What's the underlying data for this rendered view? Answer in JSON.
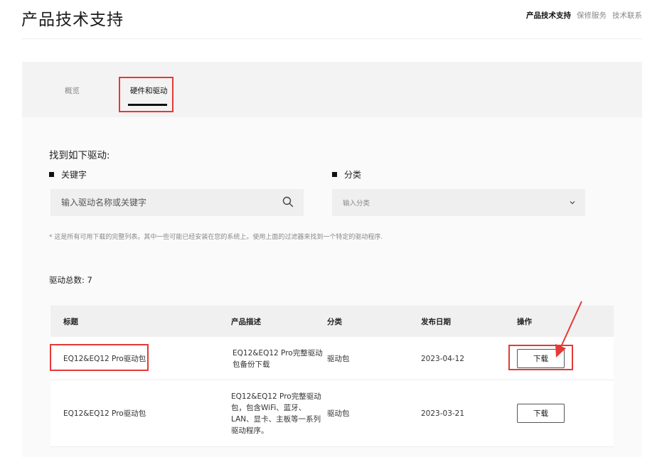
{
  "header": {
    "title": "产品技术支持",
    "nav": [
      {
        "label": "产品技术支持",
        "active": true
      },
      {
        "label": "保修服务",
        "active": false
      },
      {
        "label": "技术联系",
        "active": false
      }
    ]
  },
  "tabs": [
    {
      "label": "概览",
      "active": false
    },
    {
      "label": "硬件和驱动",
      "active": true
    }
  ],
  "drivers": {
    "section_title": "找到如下驱动:",
    "keyword_label": "关键字",
    "keyword_placeholder": "输入驱动名称或关键字",
    "category_label": "分类",
    "category_placeholder": "输入分类",
    "note": "* 这是所有可用下载的完整列表。其中一些可能已经安装在您的系统上。使用上面的过滤器来找到一个特定的驱动程序.",
    "total": "驱动总数: 7"
  },
  "table": {
    "headers": [
      "标题",
      "产品描述",
      "分类",
      "发布日期",
      "操作"
    ],
    "rows": [
      {
        "title": "EQ12&EQ12 Pro驱动包",
        "desc_lines": [
          "EQ12&EQ12 Pro完整驱动",
          "包备份下载"
        ],
        "category": "驱动包",
        "date": "2023-04-12",
        "action": "下载"
      },
      {
        "title": "EQ12&EQ12 Pro驱动包",
        "desc_lines": [
          "EQ12&EQ12 Pro完整驱动",
          "包，包含WiFi、蓝牙、",
          "LAN、显卡、主板等一系列",
          "驱动程序。"
        ],
        "category": "驱动包",
        "date": "2023-03-21",
        "action": "下载"
      }
    ]
  },
  "colors": {
    "annotation_red": "#e53935",
    "panel_bg": "#fafafa",
    "input_bg": "#efefef"
  },
  "icons": {
    "search": "search-icon",
    "chevron": "chevron-down-icon"
  }
}
